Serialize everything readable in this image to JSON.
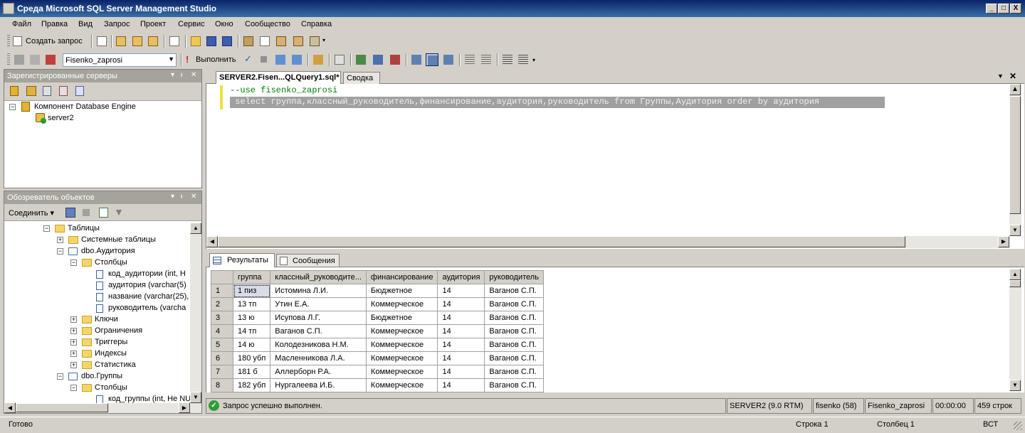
{
  "window": {
    "title": "Среда Microsoft SQL Server Management Studio",
    "minimize": "_",
    "maximize": "□",
    "close": "X"
  },
  "menu": [
    "Файл",
    "Правка",
    "Вид",
    "Запрос",
    "Проект",
    "Сервис",
    "Окно",
    "Сообщество",
    "Справка"
  ],
  "toolbar1": {
    "new_query": "Создать запрос"
  },
  "toolbar2": {
    "database": "Fisenko_zaprosi",
    "execute": "Выполнить"
  },
  "registered": {
    "title": "Зарегистрированные серверы",
    "root": "Компонент Database Engine",
    "server": "server2"
  },
  "explorer": {
    "title": "Обозреватель объектов",
    "connect": "Соединить",
    "nodes": [
      "Таблицы",
      "Системные таблицы",
      "dbo.Аудитория",
      "Столбцы",
      "код_аудитории (int, Н",
      "аудитория (varchar(5)",
      "название (varchar(25),",
      "руководитель (varcha",
      "Ключи",
      "Ограничения",
      "Триггеры",
      "Индексы",
      "Статистика",
      "dbo.Группы",
      "Столбцы",
      "код_группы (int, Не NU"
    ]
  },
  "editor": {
    "tab_active": "SERVER2.Fisen...QLQuery1.sql*",
    "tab_other": "Сводка",
    "line1": "--use fisenko_zaprosi",
    "line2": " select группа,классный_руководитель,финансирование,аудитория,руководитель from Группы,Аудитория order by аудитория"
  },
  "results": {
    "tab_results": "Результаты",
    "tab_messages": "Сообщения",
    "columns": [
      "группа",
      "классный_руководите...",
      "финансирование",
      "аудитория",
      "руководитель"
    ],
    "rows": [
      [
        "1",
        "1 пиз",
        "Истомина Л.И.",
        "Бюджетное",
        "14",
        "Ваганов С.П."
      ],
      [
        "2",
        "13 тп",
        "Утин Е.А.",
        "Коммерческое",
        "14",
        "Ваганов С.П."
      ],
      [
        "3",
        "13 ю",
        "Исупова Л.Г.",
        "Бюджетное",
        "14",
        "Ваганов С.П."
      ],
      [
        "4",
        "14 тп",
        "Ваганов С.П.",
        "Коммерческое",
        "14",
        "Ваганов С.П."
      ],
      [
        "5",
        "14 ю",
        "Колодезникова Н.М.",
        "Коммерческое",
        "14",
        "Ваганов С.П."
      ],
      [
        "6",
        "180 убп",
        "Масленникова Л.А.",
        "Коммерческое",
        "14",
        "Ваганов С.П."
      ],
      [
        "7",
        "181 б",
        "Аллерборн Р.А.",
        "Коммерческое",
        "14",
        "Ваганов С.П."
      ],
      [
        "8",
        "182 убп",
        "Нургалеева И.Б.",
        "Коммерческое",
        "14",
        "Ваганов С.П."
      ]
    ]
  },
  "querystatus": {
    "message": "Запрос успешно выполнен.",
    "server": "SERVER2 (9.0 RTM)",
    "user": "fisenko (58)",
    "db": "Fisenko_zaprosi",
    "time": "00:00:00",
    "rows": "459 строк"
  },
  "statusbar": {
    "ready": "Готово",
    "line": "Строка 1",
    "col": "Столбец 1",
    "mode": "ВСТ"
  },
  "colors": {
    "title_active": "#0a246a",
    "panel_title": "#a6a39b",
    "selection": "#808080",
    "ok": "#2e9e3a"
  }
}
